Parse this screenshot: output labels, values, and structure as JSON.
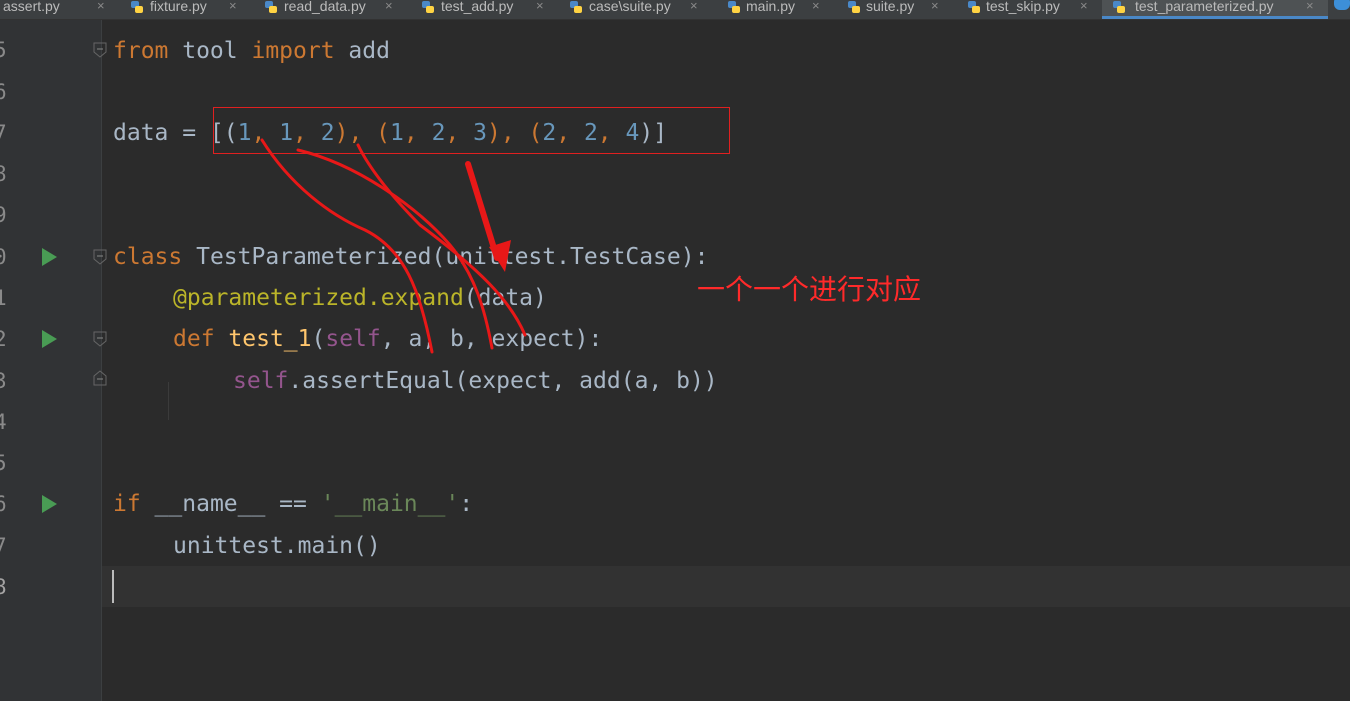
{
  "tabs": [
    {
      "label": "assert.py",
      "active": false
    },
    {
      "label": "fixture.py",
      "active": false
    },
    {
      "label": "read_data.py",
      "active": false
    },
    {
      "label": "test_add.py",
      "active": false
    },
    {
      "label": "case\\suite.py",
      "active": false
    },
    {
      "label": "main.py",
      "active": false
    },
    {
      "label": "suite.py",
      "active": false
    },
    {
      "label": "test_skip.py",
      "active": false
    },
    {
      "label": "test_parameterized.py",
      "active": true
    }
  ],
  "line_numbers": [
    "5",
    "6",
    "7",
    "8",
    "9",
    "0",
    "1",
    "2",
    "3",
    "4",
    "5",
    "6",
    "7",
    "8"
  ],
  "code": {
    "l5": {
      "kw1": "from",
      "mod": " tool ",
      "kw2": "import",
      "name": " add"
    },
    "l7": {
      "prefix": "data = [(",
      "n1": "1",
      "c1": ", ",
      "n2": "1",
      "c2": ", ",
      "n3": "2",
      "p1": "), (",
      "n4": "1",
      "c3": ", ",
      "n5": "2",
      "c4": ", ",
      "n6": "3",
      "p2": "), (",
      "n7": "2",
      "c5": ", ",
      "n8": "2",
      "c6": ", ",
      "n9": "4",
      "suffix": ")]"
    },
    "l10": {
      "kw": "class",
      "rest": " TestParameterized(unittest.TestCase):"
    },
    "l11": {
      "dec": "@parameterized.expand",
      "rest": "(data)"
    },
    "l12": {
      "kw": "def",
      "sp": " ",
      "fn": "test_1",
      "open": "(",
      "self": "self",
      "rest": ", a, b, expect):"
    },
    "l13": {
      "self": "self",
      "rest": ".assertEqual(expect, add(a, b))"
    },
    "l16": {
      "kw": "if",
      "mid": " __name__ == ",
      "str": "'__main__'",
      "end": ":"
    },
    "l17": {
      "text": "unittest.main()"
    }
  },
  "annotation": {
    "text": "一个一个进行对应",
    "color": "#ff2a2a"
  },
  "colors": {
    "keyword": "#cc7832",
    "number": "#6897bb",
    "decorator": "#bbb529",
    "self": "#94558d",
    "function": "#ffc66d",
    "string": "#6a8759",
    "text": "#a9b7c6",
    "run": "#499c54"
  }
}
